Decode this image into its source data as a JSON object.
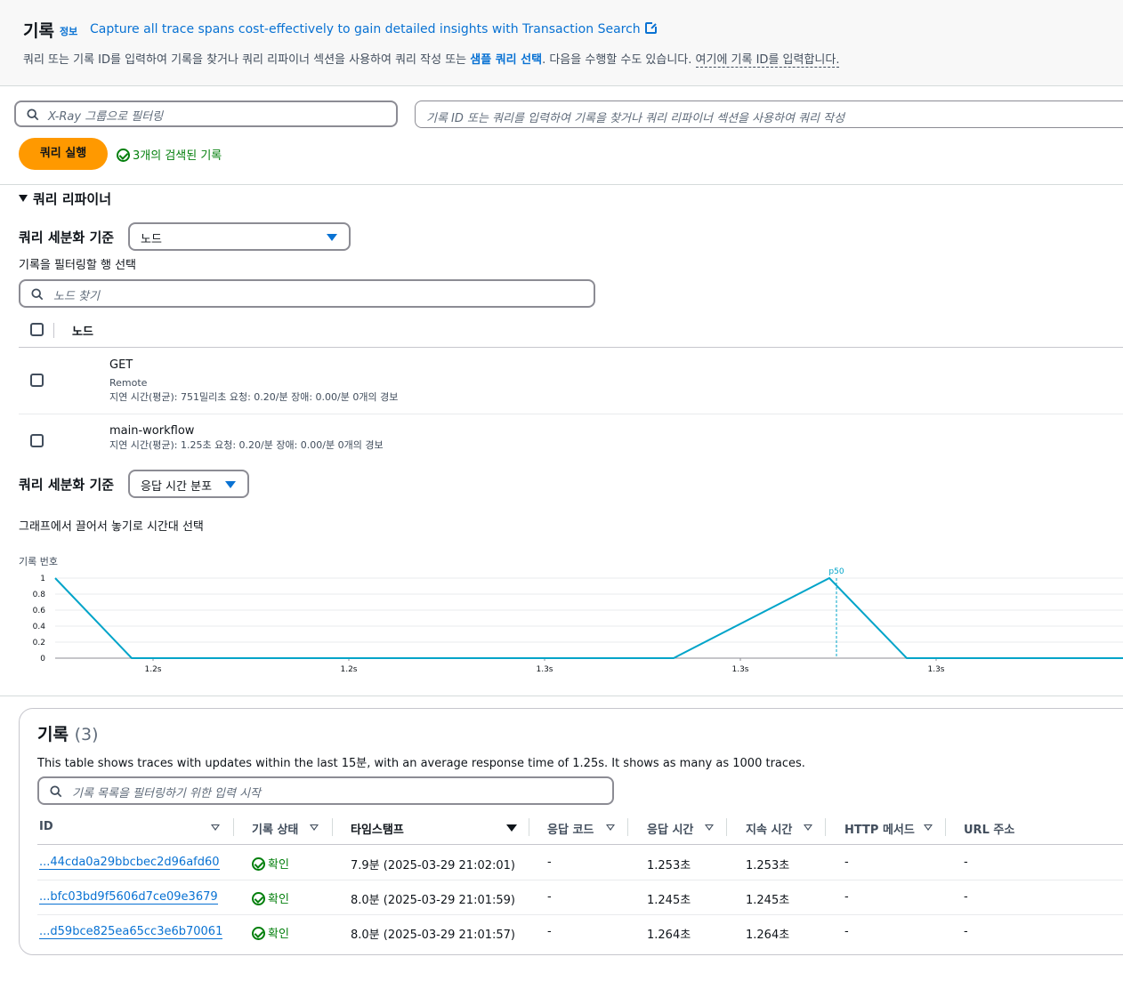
{
  "header": {
    "title": "기록",
    "info": "정보",
    "banner_link": "Capture all trace spans cost-effectively to gain detailed insights with Transaction Search",
    "desc_part1": "쿼리 또는 기록 ID를 입력하여 기록을 찾거나 쿼리 리파이너 섹션을 사용하여 쿼리 작성 또는 ",
    "desc_link": "샘플 쿼리 선택",
    "desc_part2": ". 다음을 수행할 수도 있습니다. ",
    "desc_dotted": "여기에 기록 ID를 입력합니다."
  },
  "filters": {
    "group_placeholder": "X-Ray 그룹으로 필터링",
    "query_placeholder": "기록 ID 또는 쿼리를 입력하여 기록을 찾거나 쿼리 리파이너 섹션을 사용하여 쿼리 작성"
  },
  "run_button": "쿼리 실행",
  "retrieved_status": "3개의 검색된 기록",
  "refiner": {
    "title": "쿼리 리파이너",
    "refine_by_label": "쿼리 세분화 기준",
    "refine_by_value": "노드",
    "select_rows_label": "기록을 필터링할 행 선택",
    "node_search_placeholder": "노드 찾기",
    "column_node": "노드",
    "nodes": [
      {
        "name": "GET",
        "type": "Remote",
        "stats": "지연 시간(평균): 751밀리초   요청: 0.20/분   장애: 0.00/분   0개의 경보"
      },
      {
        "name": "main-workflow",
        "type": "",
        "stats": "지연 시간(평균): 1.25초   요청: 0.20/분   장애: 0.00/분   0개의 경보"
      }
    ],
    "refine_by_label2": "쿼리 세분화 기준",
    "refine_by_value2": "응답 시간 분포",
    "drag_hint": "그래프에서 끌어서 놓기로 시간대 선택"
  },
  "chart_data": {
    "type": "line",
    "ylabel": "기록 번호",
    "y_ticks": [
      "0",
      "0.2",
      "0.4",
      "0.6",
      "0.8",
      "1"
    ],
    "x_ticks": [
      "1.2s",
      "1.2s",
      "1.3s",
      "1.3s",
      "1.3s"
    ],
    "ylim": [
      0,
      1
    ],
    "series": [
      {
        "values": [
          1,
          0,
          0,
          0,
          0,
          0,
          0,
          0,
          0,
          1,
          0,
          0,
          0
        ]
      }
    ],
    "marker_label": "p50",
    "color": "#01a4c9"
  },
  "traces": {
    "title": "기록",
    "count": "(3)",
    "description": "This table shows traces with updates within the last 15분, with an average response time of 1.25s. It shows as many as 1000 traces.",
    "filter_placeholder": "기록 목록을 필터링하기 위한 입력 시작",
    "columns": [
      "ID",
      "기록 상태",
      "타임스탬프",
      "응답 코드",
      "응답 시간",
      "지속 시간",
      "HTTP 메서드",
      "URL 주소"
    ],
    "rows": [
      {
        "id": "...44cda0a29bbcbec2d96afd60",
        "status": "확인",
        "timestamp": "7.9분 (2025-03-29 21:02:01)",
        "code": "-",
        "response": "1.253초",
        "duration": "1.253초",
        "method": "-",
        "url": "-"
      },
      {
        "id": "...bfc03bd9f5606d7ce09e3679",
        "status": "확인",
        "timestamp": "8.0분 (2025-03-29 21:01:59)",
        "code": "-",
        "response": "1.245초",
        "duration": "1.245초",
        "method": "-",
        "url": "-"
      },
      {
        "id": "...d59bce825ea65cc3e6b70061",
        "status": "확인",
        "timestamp": "8.0분 (2025-03-29 21:01:57)",
        "code": "-",
        "response": "1.264초",
        "duration": "1.264초",
        "method": "-",
        "url": "-"
      }
    ]
  },
  "colors": {
    "accent": "#0972d3",
    "primary_button": "#ff9900",
    "success": "#037f0c"
  }
}
